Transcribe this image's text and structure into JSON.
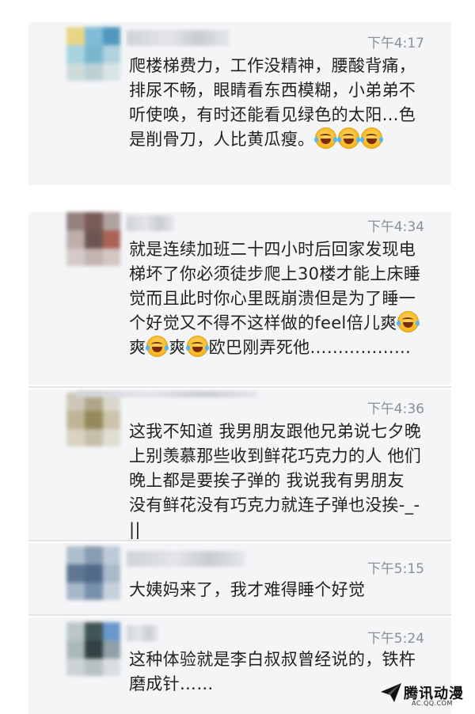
{
  "messages": [
    {
      "time": "下午4:17",
      "text": "爬楼梯费力，工作没精神，腰酸背痛，排尿不畅，眼睛看东西模糊，小弟弟不听使唤，有时还能看见绿色的太阳…色是削骨刀，人比黄瓜瘦。",
      "emoji_count": 3
    },
    {
      "time": "下午4:34",
      "text_a": "就是连续加班二十四小时后回家发现电梯坏了你必须徒步爬上30楼才能上床睡觉而且此时你心里既崩溃但是为了睡一个好觉又不得不这样做的feel倍儿爽",
      "text_b": "爽",
      "text_c": "爽",
      "text_d": "欧巴刚弄死他………………"
    },
    {
      "time": "下午4:36",
      "text": "这我不知道 我男朋友跟他兄弟说七夕晚上别羡慕那些收到鲜花巧克力的人 他们晚上都是要挨子弹的  我说我有男朋友 没有鲜花没有巧克力就连子弹也没挨-_-||"
    },
    {
      "time": "下午5:15",
      "text": "大姨妈来了，我才难得睡个好觉"
    },
    {
      "time": "下午5:24",
      "text": "这种体验就是李白叔叔曾经说的，铁杵磨成针……"
    }
  ],
  "watermark": {
    "brand": "腾讯动漫",
    "url": "AC.QQ.COM"
  },
  "emoji_name": "tears-of-joy-emoji",
  "colors": {
    "card_bg": "#f4f5f7",
    "time_text": "#8a8f96",
    "message_text": "#222222"
  }
}
